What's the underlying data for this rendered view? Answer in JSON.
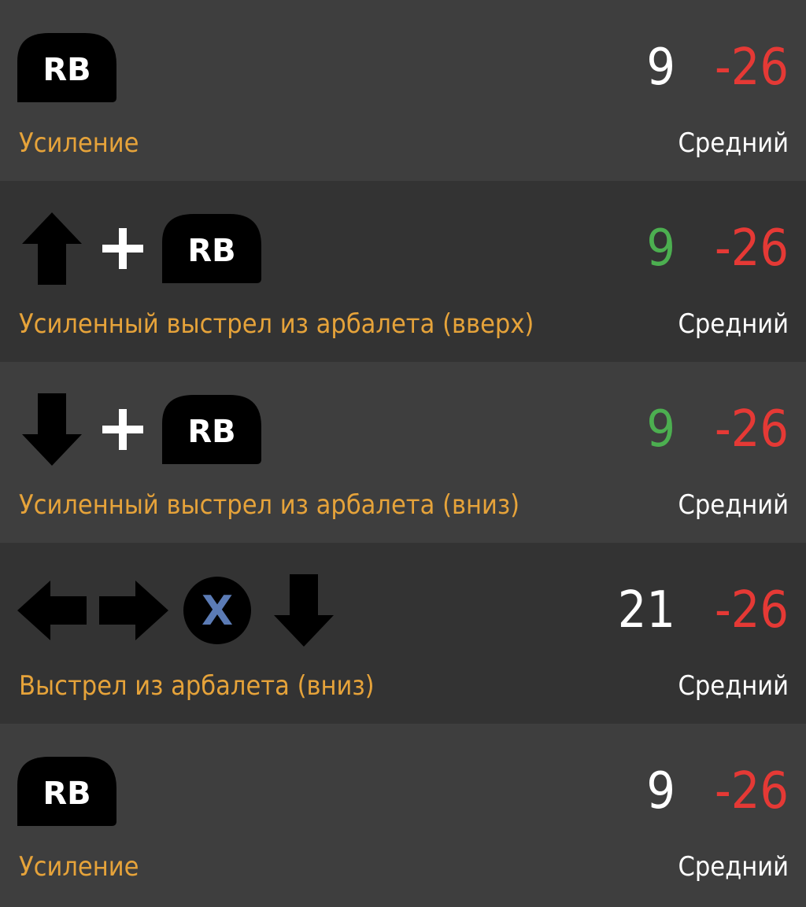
{
  "colors": {
    "row_light": "#3e3e3e",
    "row_dark": "#333333",
    "move_name": "#e6a33a",
    "frame_neutral": "#ffffff",
    "frame_good": "#4caf50",
    "frame_bad": "#e53935",
    "button_bg": "#000000",
    "x_button_letter": "#5b7bb5"
  },
  "moves": [
    {
      "inputs": [
        {
          "type": "button",
          "label": "RB",
          "icon": "rb-button-icon"
        }
      ],
      "startup": "9",
      "startup_color": "neutral",
      "advantage": "-26",
      "name": "Усиление",
      "hit_level": "Средний"
    },
    {
      "inputs": [
        {
          "type": "arrow-up",
          "icon": "arrow-up-icon"
        },
        {
          "type": "plus",
          "icon": "plus-icon"
        },
        {
          "type": "button",
          "label": "RB",
          "icon": "rb-button-icon"
        }
      ],
      "startup": "9",
      "startup_color": "good",
      "advantage": "-26",
      "name": "Усиленный выстрел из арбалета (вверх)",
      "hit_level": "Средний"
    },
    {
      "inputs": [
        {
          "type": "arrow-down",
          "icon": "arrow-down-icon"
        },
        {
          "type": "plus",
          "icon": "plus-icon"
        },
        {
          "type": "button",
          "label": "RB",
          "icon": "rb-button-icon"
        }
      ],
      "startup": "9",
      "startup_color": "good",
      "advantage": "-26",
      "name": "Усиленный выстрел из арбалета (вниз)",
      "hit_level": "Средний"
    },
    {
      "inputs": [
        {
          "type": "arrow-left",
          "icon": "arrow-left-icon"
        },
        {
          "type": "arrow-right",
          "icon": "arrow-right-icon"
        },
        {
          "type": "x-button",
          "label": "X",
          "icon": "x-button-icon"
        },
        {
          "type": "arrow-down",
          "icon": "arrow-down-icon"
        }
      ],
      "startup": "21",
      "startup_color": "neutral",
      "advantage": "-26",
      "name": "Выстрел из арбалета (вниз)",
      "hit_level": "Средний"
    },
    {
      "inputs": [
        {
          "type": "button",
          "label": "RB",
          "icon": "rb-button-icon"
        }
      ],
      "startup": "9",
      "startup_color": "neutral",
      "advantage": "-26",
      "name": "Усиление",
      "hit_level": "Средний"
    }
  ]
}
